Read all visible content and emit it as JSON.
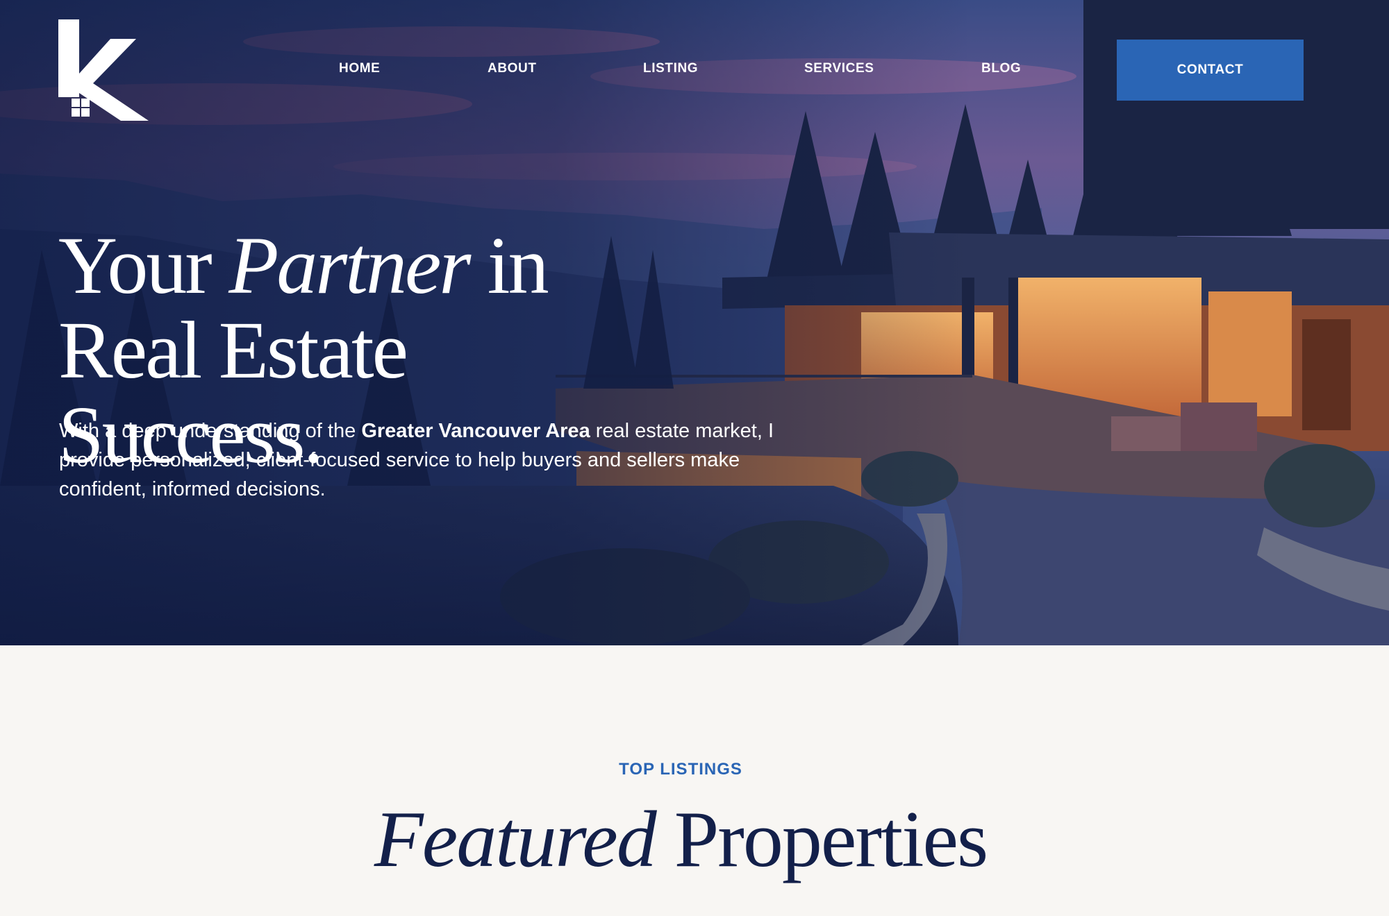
{
  "brand": {
    "logo_letter": "K",
    "colors": {
      "accent": "#2a65b5",
      "navy": "#13204a",
      "hero_overlay": "#0e1a42",
      "section_bg": "#f8f6f3"
    }
  },
  "nav": {
    "items": [
      {
        "label": "HOME"
      },
      {
        "label": "ABOUT"
      },
      {
        "label": "LISTING"
      },
      {
        "label": "SERVICES"
      },
      {
        "label": "BLOG"
      }
    ],
    "contact_label": "CONTACT"
  },
  "hero": {
    "title_line1_a": "Your ",
    "title_line1_em": "Partner",
    "title_line1_b": " in",
    "title_line2": "Real Estate Success.",
    "desc_a": "With a deep understanding of the ",
    "desc_bold": "Greater Vancouver Area",
    "desc_b": " real estate market, I provide personalized, client-focused service to help buyers and sellers make confident, informed decisions."
  },
  "featured": {
    "eyebrow": "TOP LISTINGS",
    "title_em": "Featured",
    "title_rest": " Properties"
  }
}
